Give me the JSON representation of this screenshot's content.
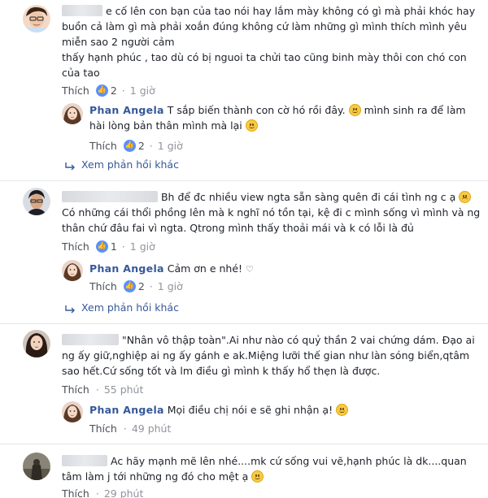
{
  "thread": {
    "like_label": "Thích",
    "view_more_label": "Xem phản hồi khác",
    "comment1": {
      "line1": "e cố lên con bạn của tao nói hay lắm mày không có gì mà phải khóc hay",
      "line2": "buồn cả làm gì mà phải xoắn đúng không cứ làm những gì mình thích mình yêu",
      "line3": "miễn sao 2 người cảm",
      "line4": "thấy hạnh phúc , tao dù có bị nguoi ta chửi tao cũng binh mày thôi con chó con",
      "line5": "của tao",
      "likes": "2",
      "time": "1 giờ",
      "reply": {
        "name": "Phan Angela",
        "line1": "T sắp biến thành con cờ hó rồi đây.",
        "line1b": "mình sinh ra để làm",
        "line2": "hài lòng bản thân mình mà lại",
        "likes": "2",
        "time": "1 giờ"
      }
    },
    "comment2": {
      "line1": "Bh để đc nhiều view ngta sẵn sàng quên đi cái tình ng c ạ",
      "line2": "Có những cái thổi phồng lên mà k nghĩ nó tồn tại, kệ đi c mình sống vì mình và ng",
      "line3": "thân chứ đâu fai vì ngta. Qtrong mình thấy thoải mái và k có lỗi là đủ",
      "likes": "1",
      "time": "1 giờ",
      "reply": {
        "name": "Phan Angela",
        "text": "Cảm ơn e nhé!",
        "likes": "2",
        "time": "1 giờ"
      }
    },
    "comment3": {
      "line1": "\"Nhân vô thập toàn\".Ai như nào có quỷ thần 2 vai chứng dám. Đạo ai",
      "line2": "ng ấy giữ,nghiệp ai ng ấy gánh e ak.Miệng lưỡi thế gian như làn sóng biển,qtâm",
      "line3": "sao hết.Cứ sống tốt và lm điều gì mình k thấy hổ thẹn là được.",
      "time": "55 phút",
      "reply": {
        "name": "Phan Angela",
        "text": "Mọi điều chị nói e sẽ ghi nhận ạ!",
        "time": "49 phút"
      }
    },
    "comment4": {
      "line1": "Ac hãy mạnh mẽ lên nhé....mk cứ sống vui vẽ,hạnh phúc là dk....quan",
      "line2": "tâm làm j tới những ng đó cho mệt ạ",
      "time": "29 phút"
    },
    "colors": {
      "link": "#365899",
      "meta": "#90949c",
      "like_badge": "#5890ff"
    }
  }
}
